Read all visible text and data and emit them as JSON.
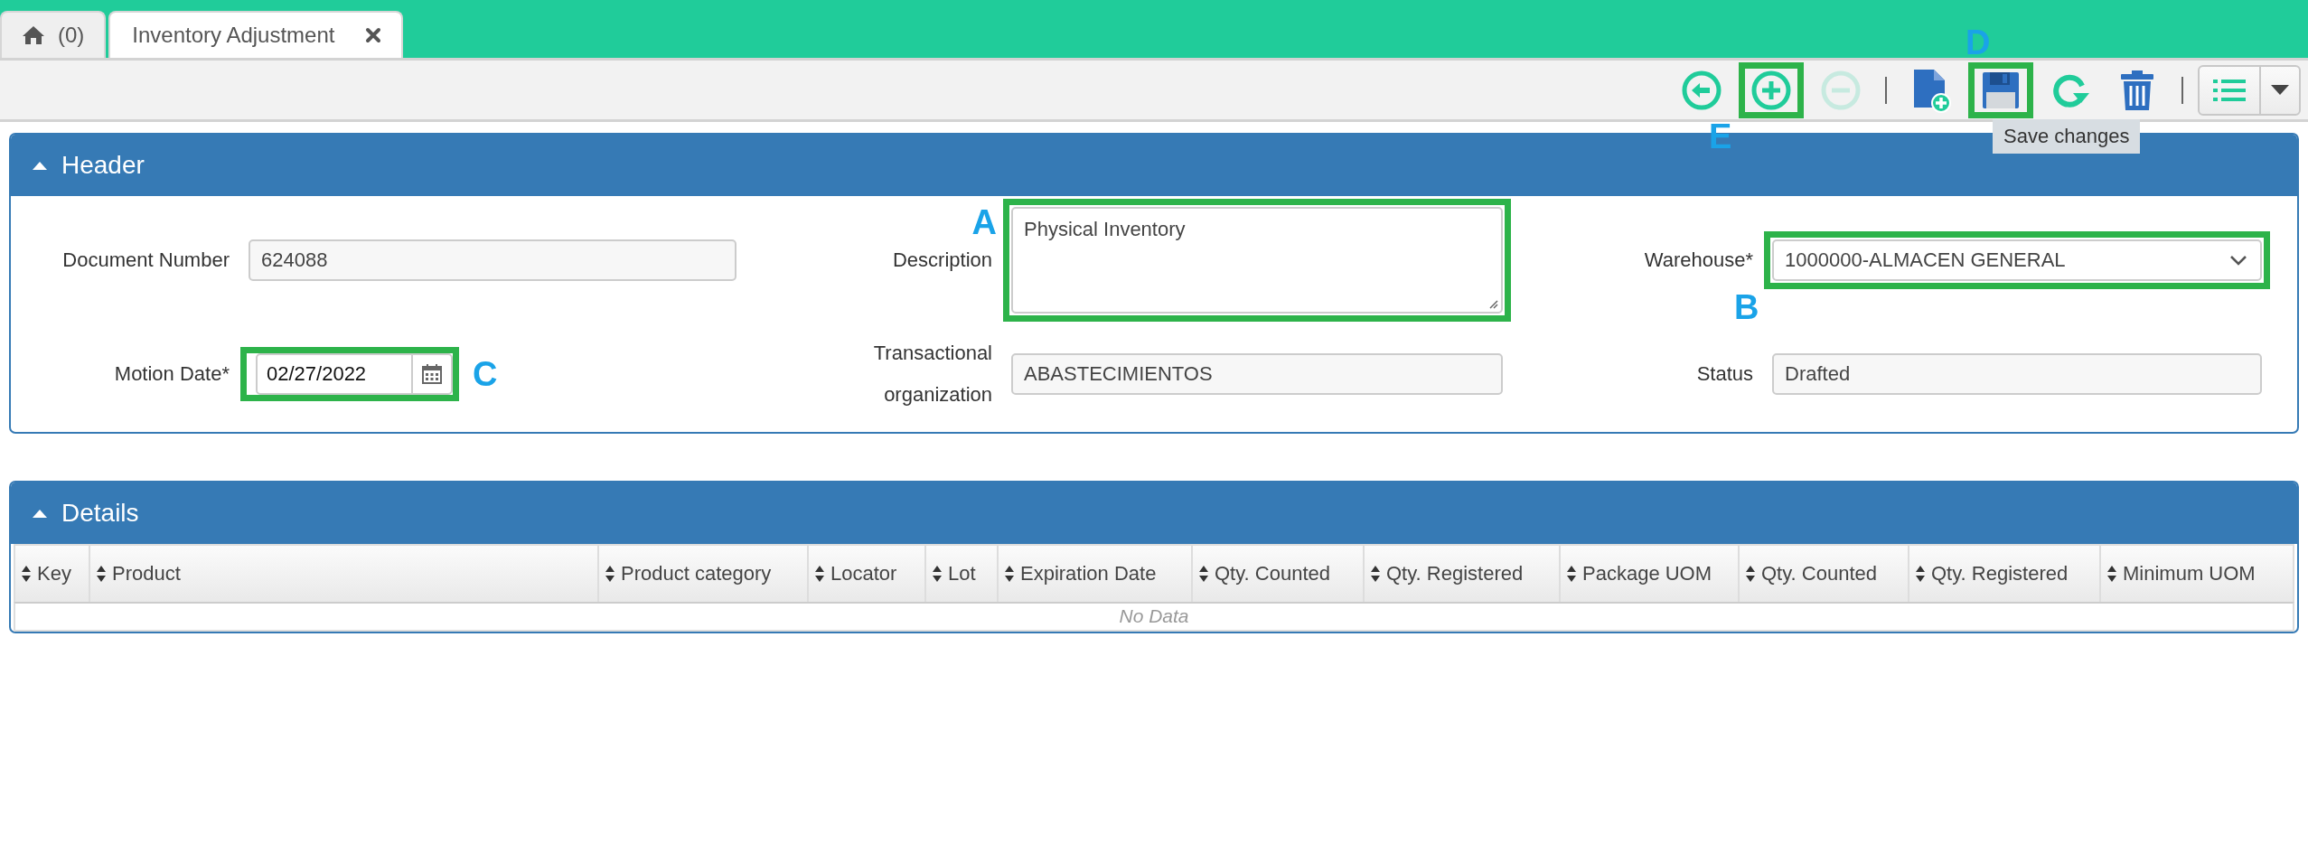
{
  "tabs": [
    {
      "kind": "home",
      "label": "(0)",
      "selected": false,
      "closable": false
    },
    {
      "kind": "document",
      "label": "Inventory Adjustment",
      "selected": true,
      "closable": true
    }
  ],
  "toolbar": {
    "buttons": [
      {
        "kind": "back",
        "disabled": false,
        "highlighted": false
      },
      {
        "kind": "add",
        "disabled": false,
        "highlighted": true,
        "annotation": {
          "letter": "E"
        }
      },
      {
        "kind": "remove",
        "disabled": true,
        "highlighted": false
      },
      {
        "kind": "separator"
      },
      {
        "kind": "new-document",
        "disabled": false,
        "highlighted": false
      },
      {
        "kind": "save",
        "disabled": false,
        "highlighted": true,
        "annotation": {
          "letter": "D"
        },
        "tooltip": "Save changes"
      },
      {
        "kind": "refresh",
        "disabled": false,
        "highlighted": false
      },
      {
        "kind": "delete",
        "disabled": false,
        "highlighted": false
      },
      {
        "kind": "separator"
      },
      {
        "kind": "list-menu",
        "disabled": false,
        "highlighted": false
      }
    ]
  },
  "header": {
    "title": "Header",
    "expanded": true,
    "fields": [
      {
        "kind": "text",
        "label": "Document Number",
        "value": "624088",
        "readonly": true,
        "highlighted": false
      },
      {
        "kind": "textarea",
        "label": "Description",
        "value": "Physical Inventory",
        "readonly": false,
        "highlighted": true,
        "annotation": {
          "letter": "A"
        }
      },
      {
        "kind": "select",
        "label": "Warehouse*",
        "value": "1000000-ALMACEN GENERAL",
        "readonly": false,
        "highlighted": true,
        "annotation": {
          "letter": "B"
        }
      },
      {
        "kind": "date",
        "label": "Motion Date*",
        "value": "02/27/2022",
        "readonly": false,
        "highlighted": true,
        "annotation": {
          "letter": "C"
        }
      },
      {
        "kind": "text",
        "label": "Transactional organization",
        "value": "ABASTECIMIENTOS",
        "readonly": true,
        "highlighted": false
      },
      {
        "kind": "text",
        "label": "Status",
        "value": "Drafted",
        "readonly": true,
        "highlighted": false
      }
    ]
  },
  "details": {
    "title": "Details",
    "expanded": true,
    "columns": [
      "Key",
      "Product",
      "Product category",
      "Locator",
      "Lot",
      "Expiration Date",
      "Qty. Counted",
      "Qty. Registered",
      "Package UOM",
      "Qty. Counted",
      "Qty. Registered",
      "Minimum UOM"
    ],
    "empty_text": "No Data"
  }
}
